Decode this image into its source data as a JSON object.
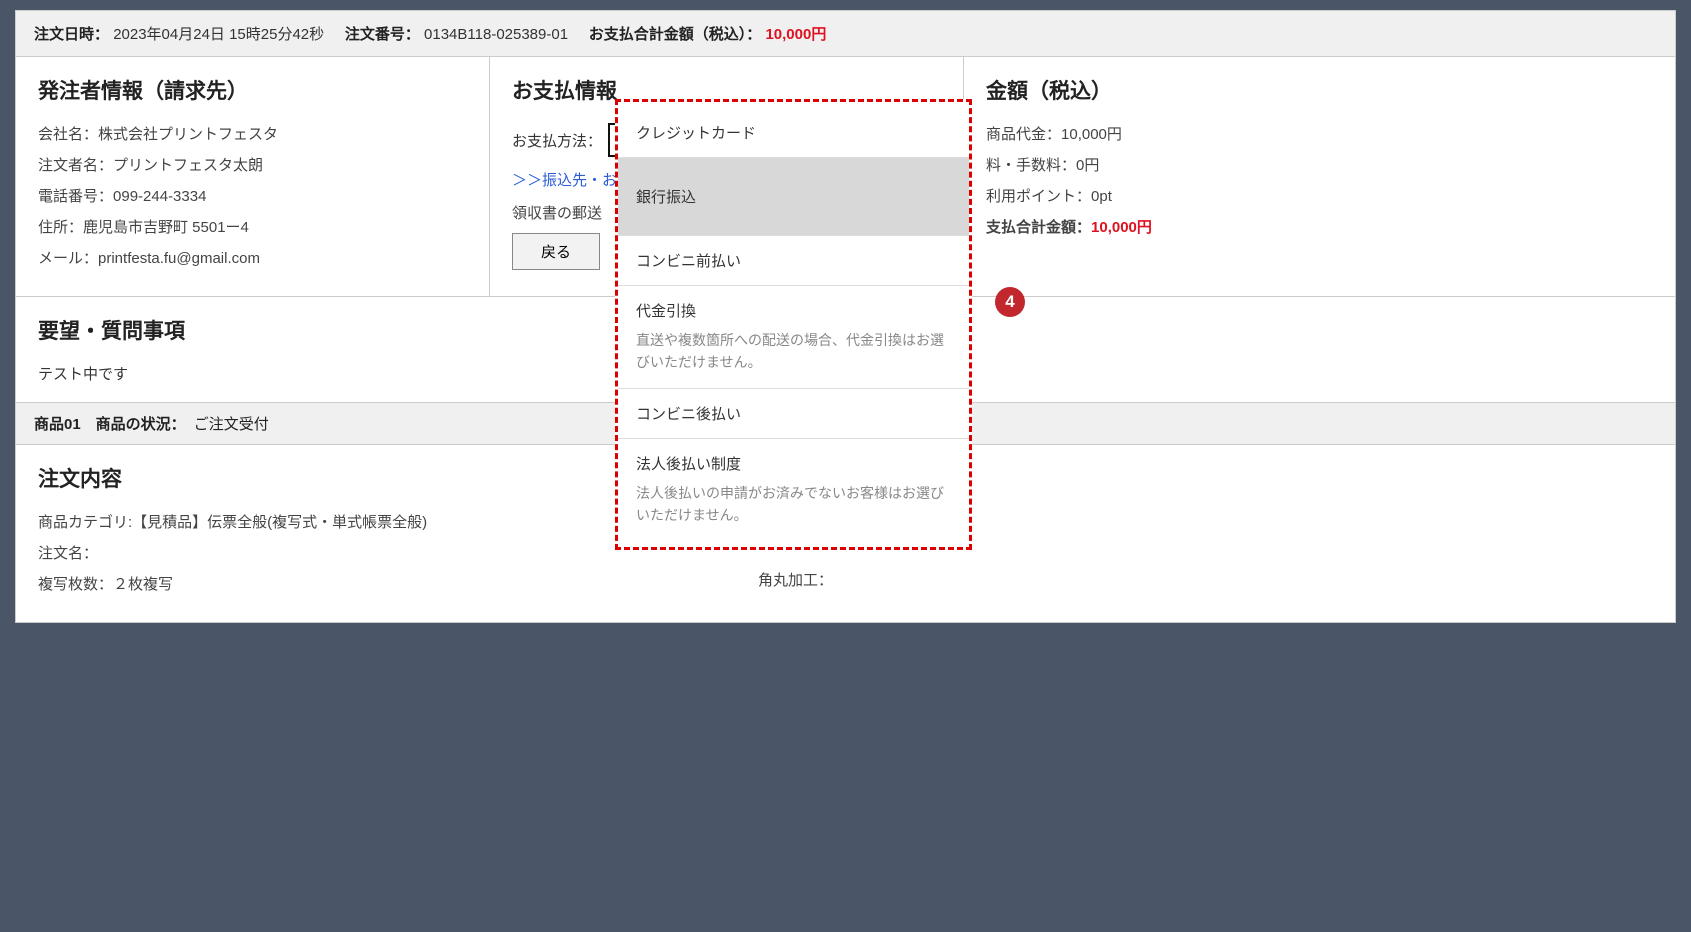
{
  "header": {
    "order_date_label": "注文日時：",
    "order_date_value": "2023年04月24日 15時25分42秒",
    "order_num_label": "注文番号：",
    "order_num_value": "0134B118-025389-01",
    "pay_total_label": "お支払合計金額（税込）：",
    "pay_total_value": "10,000円"
  },
  "orderer": {
    "title": "発注者情報（請求先）",
    "company_label": "会社名：",
    "company_value": "株式会社プリントフェスタ",
    "name_label": "注文者名：",
    "name_value": "プリントフェスタ太朗",
    "phone_label": "電話番号：",
    "phone_value": "099-244-3334",
    "address_label": "住所：",
    "address_value": "鹿児島市吉野町 5501ー4",
    "email_label": "メール：",
    "email_value": "printfesta.fu@gmail.com"
  },
  "payment": {
    "title": "お支払情報",
    "method_label": "お支払方法：",
    "link_text": "＞＞振込先・お",
    "receipt_label": "領収書の郵送",
    "back_button": "戻る"
  },
  "dropdown": {
    "option1": "クレジットカード",
    "option2": "銀行振込",
    "option3": "コンビニ前払い",
    "option4_title": "代金引換",
    "option4_desc": "直送や複数箇所への配送の場合、代金引換はお選びいただけません。",
    "option5": "コンビニ後払い",
    "option6_title": "法人後払い制度",
    "option6_desc": "法人後払いの申請がお済みでないお客様はお選びいただけません。"
  },
  "amounts": {
    "title": "金額（税込）",
    "item_label": "商品代金：",
    "item_value": "10,000円",
    "fee_label": "料・手数料：",
    "fee_value": "0円",
    "points_label": "利用ポイント：",
    "points_value": "0pt",
    "total_label": "支払合計金額：",
    "total_value": "10,000円"
  },
  "request": {
    "title": "要望・質問事項",
    "text": "テスト中です"
  },
  "product_bar": {
    "label": "商品01　商品の状況：",
    "status": "ご注文受付"
  },
  "order_content": {
    "title": "注文内容",
    "category_label": "商品カテゴリ:",
    "category_value": "【見積品】伝票全般(複写式・単式帳票全般)",
    "order_name_label": "注文名：",
    "copies_label": "複写枚数：",
    "copies_value": "２枚複写",
    "corner_label": "角丸加工："
  },
  "badge": {
    "number": "4"
  }
}
